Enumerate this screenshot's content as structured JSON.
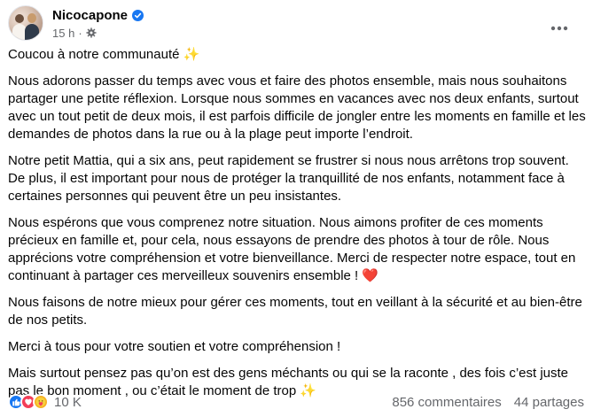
{
  "header": {
    "author": "Nicocapone",
    "time": "15 h",
    "separator": "·"
  },
  "icons": {
    "verified": "verified-badge-icon",
    "audience": "gear-icon",
    "more": "more-options-icon"
  },
  "post": {
    "greeting": "Coucou à notre communauté",
    "p1": "Nous adorons passer du temps avec vous et faire des photos ensemble, mais nous souhaitons partager une petite réflexion. Lorsque nous sommes en vacances avec nos deux enfants, surtout avec un tout petit de deux mois, il est parfois difficile de jongler entre les moments en famille et les demandes de photos dans la rue ou à la plage peut importe l’endroit.",
    "p2": "Notre petit Mattia, qui a six ans, peut rapidement se frustrer si nous nous arrêtons trop souvent. De plus, il est important pour nous de protéger la tranquillité de nos enfants, notamment face à certaines personnes qui peuvent être un peu insistantes.",
    "p3": "Nous espérons que vous comprenez notre situation. Nous aimons profiter de ces moments précieux en famille et, pour cela, nous essayons de prendre des photos à tour de rôle. Nous apprécions votre compréhension et votre bienveillance. Merci de respecter notre espace, tout en continuant à partager ces merveilleux souvenirs ensemble !",
    "p4": "Nous faisons de notre mieux pour gérer ces moments, tout en veillant à la sécurité et au bien-être de nos petits.",
    "p5": "Merci à tous pour votre soutien et votre compréhension !",
    "p6": "Mais surtout pensez pas qu’on est des gens méchants ou qui se la raconte , des fois c’est juste pas le bon moment , ou c’était le moment de trop",
    "sparkle_emoji": "✨",
    "heart_emoji": "❤️"
  },
  "footer": {
    "reactions_count": "10 K",
    "comments": "856 commentaires",
    "shares": "44 partages"
  },
  "colors": {
    "link_blue": "#1877f2",
    "secondary_text": "#65676b",
    "text": "#050505"
  }
}
